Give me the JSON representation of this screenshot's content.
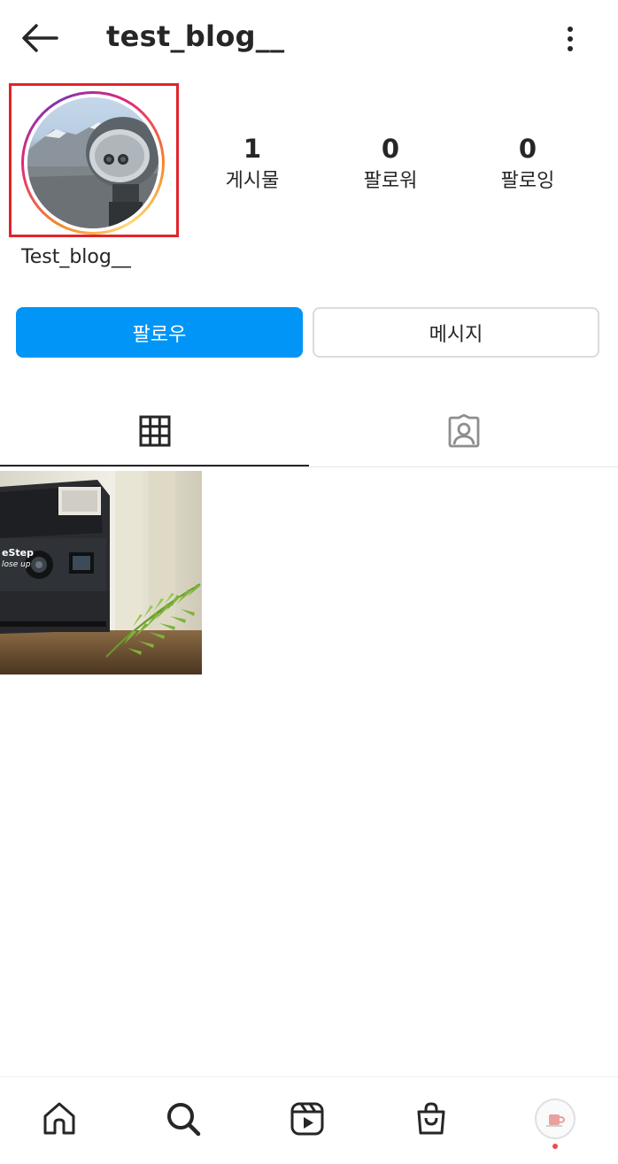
{
  "header": {
    "username": "test_blog__",
    "back_icon": "arrow-left-icon",
    "more_icon": "more-vertical-icon"
  },
  "profile": {
    "display_name": "Test_blog__",
    "avatar": "binocular-viewer-mountain-photo",
    "stats": [
      {
        "count": "1",
        "label": "게시물"
      },
      {
        "count": "0",
        "label": "팔로워"
      },
      {
        "count": "0",
        "label": "팔로잉"
      }
    ]
  },
  "actions": {
    "follow_label": "팔로우",
    "message_label": "메시지"
  },
  "tabs": [
    {
      "icon": "grid-icon",
      "active": true
    },
    {
      "icon": "tagged-person-icon",
      "active": false
    }
  ],
  "posts": [
    {
      "image": "instant-camera-with-fern-photo",
      "camera_text_1": "eStep",
      "camera_text_2": "lose up"
    }
  ],
  "bottom_nav": [
    {
      "icon": "home-icon"
    },
    {
      "icon": "search-icon"
    },
    {
      "icon": "reels-icon"
    },
    {
      "icon": "shop-icon"
    },
    {
      "icon": "profile-avatar-icon"
    }
  ],
  "colors": {
    "primary_button": "#0095f6",
    "highlight_box": "#e0242b",
    "text": "#262626",
    "notification_dot": "#ed4956"
  }
}
